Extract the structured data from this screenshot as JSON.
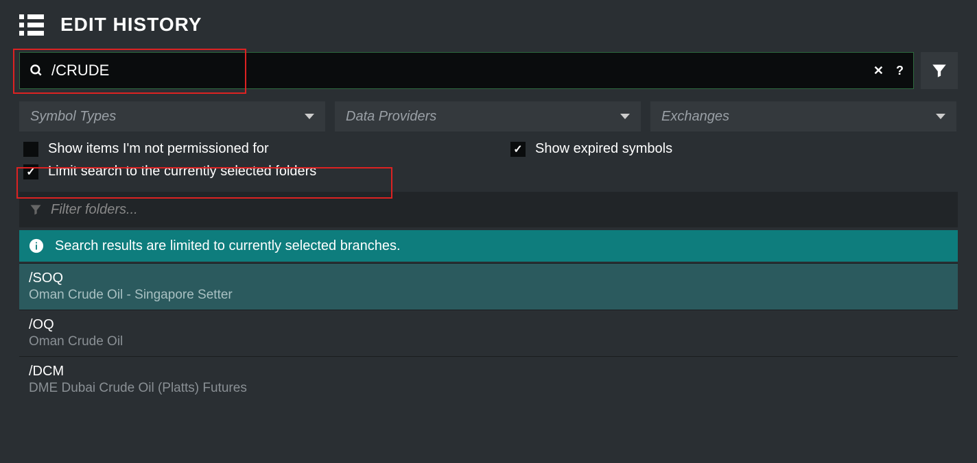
{
  "header": {
    "title": "EDIT HISTORY"
  },
  "search": {
    "value": "/CRUDE",
    "clear": "✕",
    "help": "?"
  },
  "dropdowns": {
    "symbol_types": "Symbol Types",
    "data_providers": "Data Providers",
    "exchanges": "Exchanges"
  },
  "checkboxes": {
    "not_permissioned": {
      "label": "Show items I'm not permissioned for",
      "checked": false
    },
    "show_expired": {
      "label": "Show expired symbols",
      "checked": true
    },
    "limit_search": {
      "label": "Limit search to the currently selected folders",
      "checked": true
    }
  },
  "filter_folders": {
    "placeholder": "Filter folders..."
  },
  "notice": "Search results are limited to currently selected branches.",
  "results": [
    {
      "symbol": "/SOQ",
      "desc": "Oman Crude Oil - Singapore Setter",
      "selected": true
    },
    {
      "symbol": "/OQ",
      "desc": "Oman Crude Oil",
      "selected": false
    },
    {
      "symbol": "/DCM",
      "desc": "DME Dubai Crude Oil (Platts) Futures",
      "selected": false
    }
  ]
}
